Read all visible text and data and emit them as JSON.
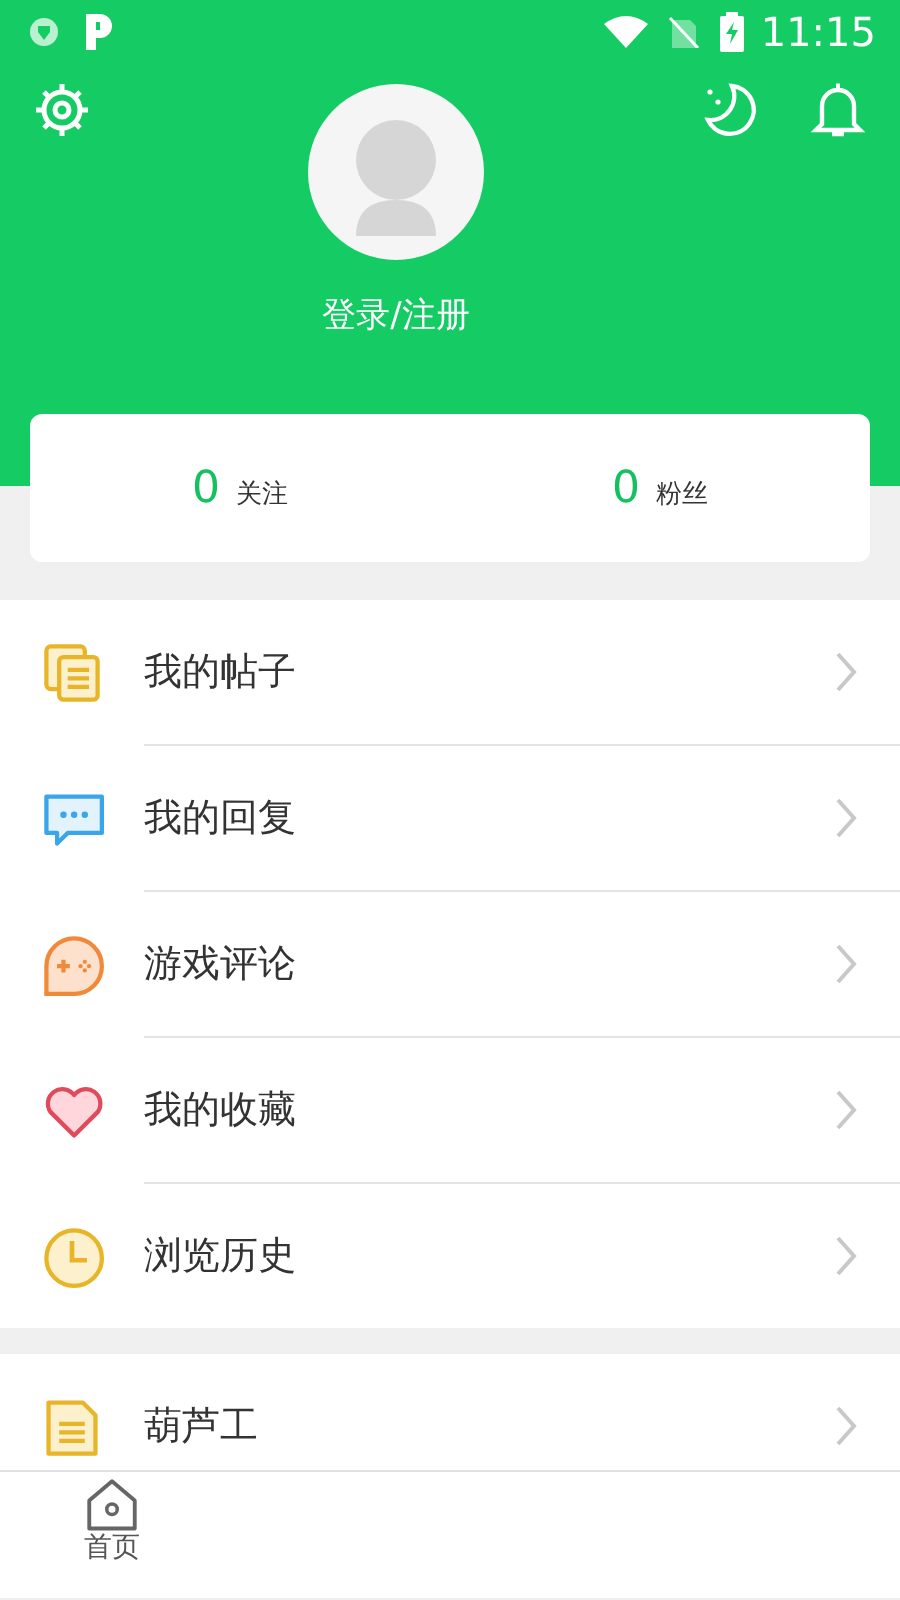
{
  "status_bar": {
    "time": "11:15"
  },
  "profile": {
    "login_label": "登录/注册"
  },
  "stats": [
    {
      "count": "0",
      "label": "关注"
    },
    {
      "count": "0",
      "label": "粉丝"
    }
  ],
  "menu": [
    {
      "label": "我的帖子",
      "kind": "posts"
    },
    {
      "label": "我的回复",
      "kind": "replies"
    },
    {
      "label": "游戏评论",
      "kind": "reviews"
    },
    {
      "label": "我的收藏",
      "kind": "favorites"
    },
    {
      "label": "浏览历史",
      "kind": "history"
    }
  ],
  "tools": [
    {
      "label": "葫芦工",
      "kind": "tool"
    }
  ],
  "bottom_nav": [
    {
      "label": "首页",
      "selected": false
    }
  ]
}
